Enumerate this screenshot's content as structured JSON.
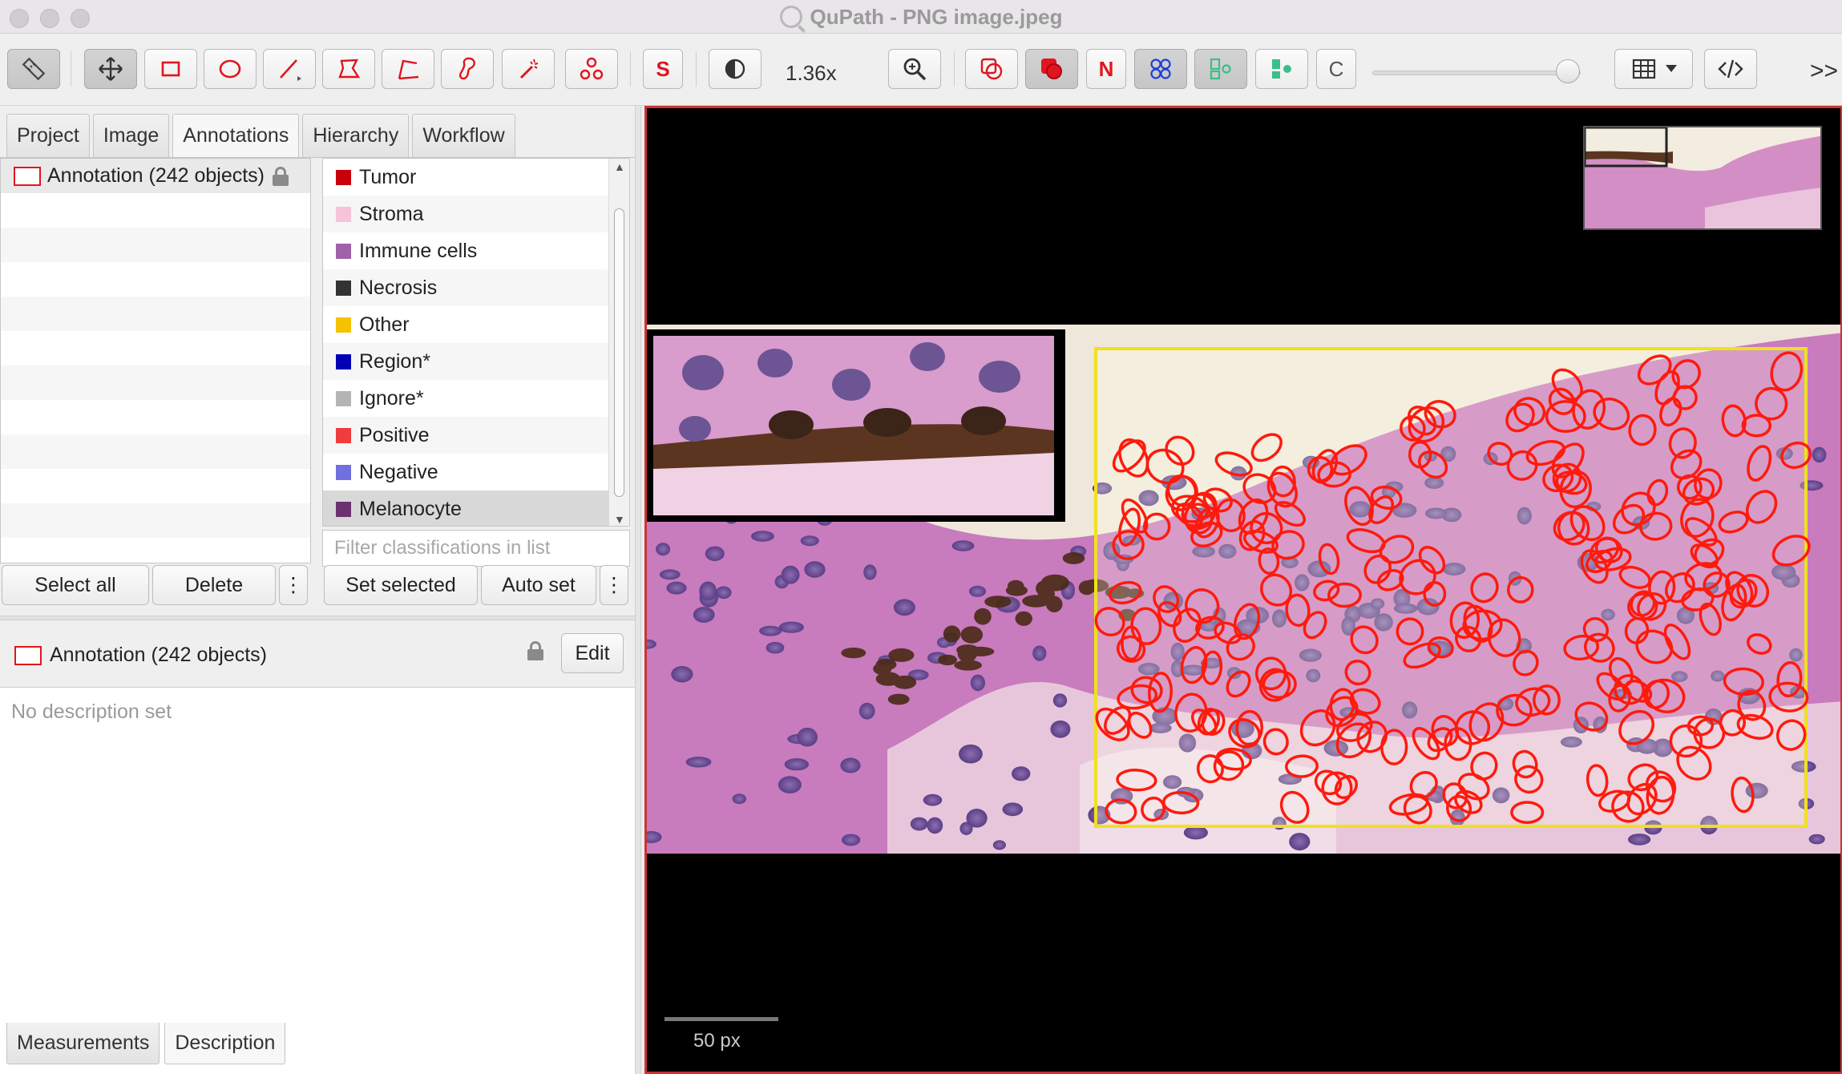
{
  "window": {
    "title": "QuPath - PNG image.jpeg"
  },
  "toolbar": {
    "zoom": "1.36x",
    "tools": [
      {
        "name": "measure-tool",
        "icon": "ruler-icon"
      },
      {
        "name": "move-tool",
        "icon": "move-arrows-icon"
      },
      {
        "name": "rectangle-tool",
        "icon": "rectangle-icon"
      },
      {
        "name": "ellipse-tool",
        "icon": "ellipse-icon"
      },
      {
        "name": "line-tool",
        "icon": "line-icon"
      },
      {
        "name": "polygon-tool",
        "icon": "polygon-icon"
      },
      {
        "name": "polyline-tool",
        "icon": "polyline-icon"
      },
      {
        "name": "brush-tool",
        "icon": "brush-icon"
      },
      {
        "name": "wand-tool",
        "icon": "wand-icon"
      },
      {
        "name": "points-tool",
        "icon": "points-icon"
      }
    ],
    "selection_mode_label": "S",
    "detections_label": "N",
    "toggle_c_label": "C",
    "opacity_value": 0.94
  },
  "left_panel": {
    "tabs": [
      "Project",
      "Image",
      "Annotations",
      "Hierarchy",
      "Workflow"
    ],
    "active_tab": "Annotations",
    "annotation_list": [
      {
        "label": "Annotation (242 objects)",
        "locked": true
      }
    ],
    "classes": [
      {
        "name": "Tumor",
        "color": "#c8000e"
      },
      {
        "name": "Stroma",
        "color": "#f7c3d6"
      },
      {
        "name": "Immune cells",
        "color": "#a060aa"
      },
      {
        "name": "Necrosis",
        "color": "#333333"
      },
      {
        "name": "Other",
        "color": "#f5c200"
      },
      {
        "name": "Region*",
        "color": "#0000b4"
      },
      {
        "name": "Ignore*",
        "color": "#b4b4b4"
      },
      {
        "name": "Positive",
        "color": "#f03c3c"
      },
      {
        "name": "Negative",
        "color": "#7070e0"
      },
      {
        "name": "Melanocyte",
        "color": "#6a3070"
      }
    ],
    "selected_class": "Melanocyte",
    "filter_placeholder": "Filter classifications in list",
    "buttons": {
      "select_all": "Select all",
      "delete": "Delete",
      "more": "⋮",
      "set_selected": "Set selected",
      "auto_set": "Auto set"
    },
    "description": {
      "title": "Annotation (242 objects)",
      "edit": "Edit",
      "empty": "No description set"
    },
    "bottom_tabs": [
      "Measurements",
      "Description"
    ],
    "active_bottom_tab": "Description"
  },
  "viewer": {
    "scalebar_label": "50 px"
  }
}
